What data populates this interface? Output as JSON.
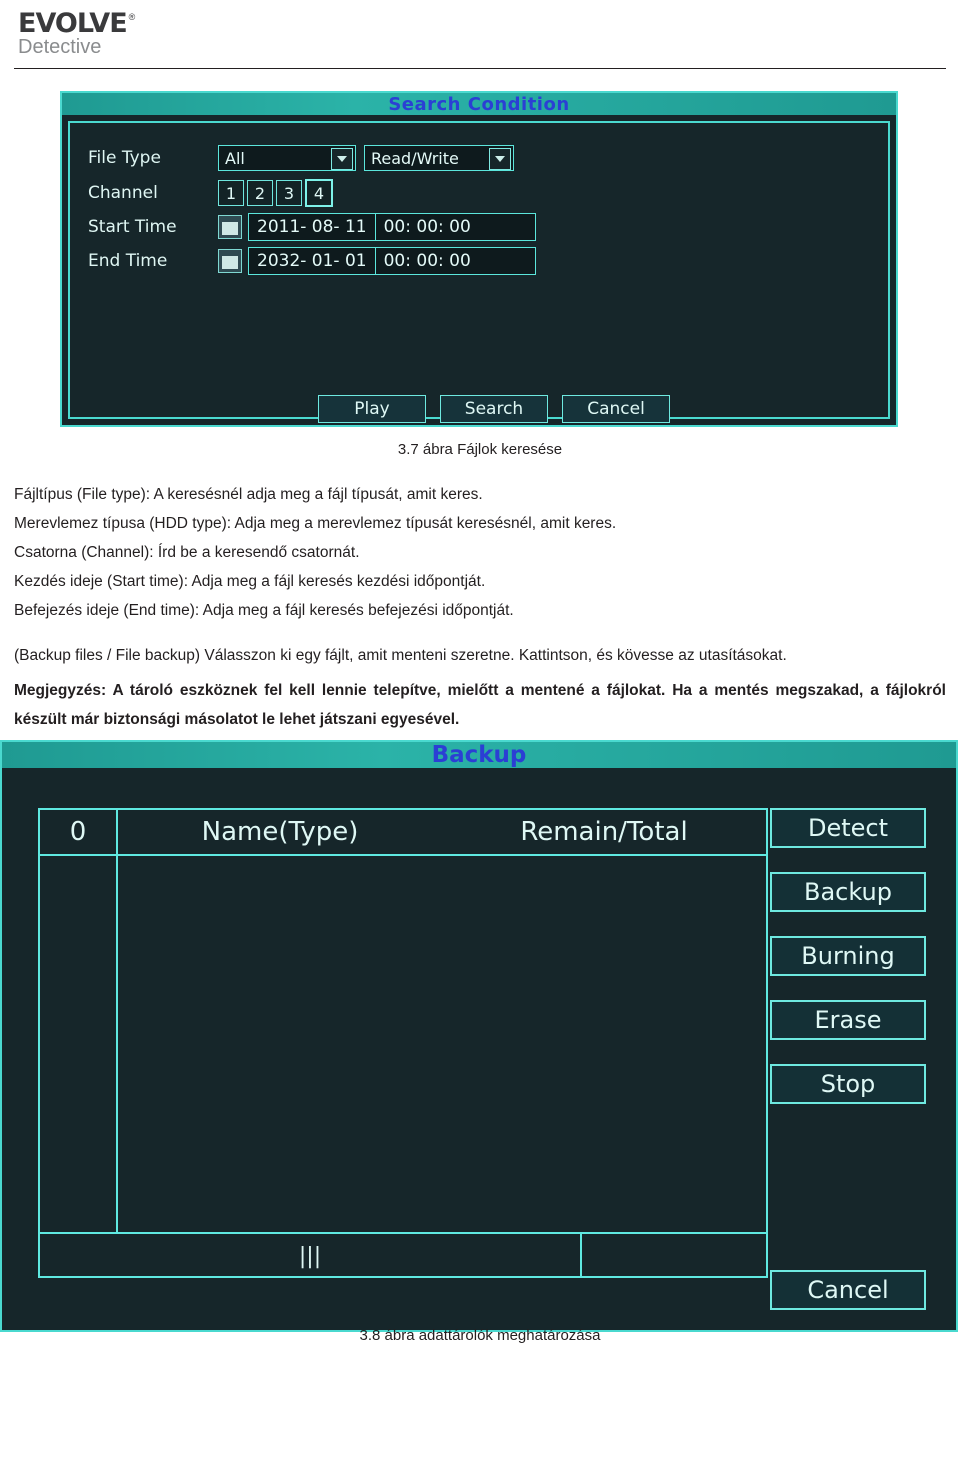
{
  "header": {
    "logo_main": "EVOLVE",
    "logo_reg": "®",
    "logo_sub": "Detective"
  },
  "figure_search": {
    "title": "Search Condition",
    "fields": {
      "file_type_label": "File Type",
      "file_type_value": "All",
      "hdd_type_value": "Read/Write",
      "channel_label": "Channel",
      "channels": [
        "1",
        "2",
        "3",
        "4"
      ],
      "start_time_label": "Start Time",
      "start_date": "2011- 08- 11",
      "start_clock": "00: 00: 00",
      "end_time_label": "End Time",
      "end_date": "2032- 01- 01",
      "end_clock": "00: 00: 00"
    },
    "buttons": {
      "play": "Play",
      "search": "Search",
      "cancel": "Cancel"
    },
    "caption": "3.7 ábra Fájlok keresése"
  },
  "body": {
    "lines": [
      "Fájltípus (File type): A keresésnél adja meg a fájl típusát, amit keres.",
      "Merevlemez típusa (HDD type): Adja meg a merevlemez típusát keresésnél, amit keres.",
      "Csatorna (Channel): Írd be a keresendő csatornát.",
      "Kezdés ideje (Start time): Adja meg a fájl keresés kezdési időpontját.",
      "Befejezés ideje (End time): Adja meg a fájl keresés befejezési időpontját."
    ],
    "para_backup": "(Backup files / File backup) Válasszon ki egy fájlt, amit menteni szeretne. Kattintson, és kövesse az utasításokat.",
    "para_note": "Megjegyzés: A tároló eszköznek fel kell lennie telepítve, mielőtt a mentené a fájlokat. Ha a mentés megszakad, a fájlokról készült már biztonsági másolatot le lehet játszani egyesével."
  },
  "figure_backup": {
    "title": "Backup",
    "columns": {
      "index": "0",
      "name_type": "Name(Type)",
      "remain_total": "Remain/Total"
    },
    "footer_value": "|||",
    "buttons": [
      "Detect",
      "Backup",
      "Burning",
      "Erase",
      "Stop"
    ],
    "cancel": "Cancel",
    "caption": "3.8 ábra adattárolók meghatározása"
  },
  "colors": {
    "panel_bg": "#16262a",
    "accent": "#4ad9cf",
    "title_text": "#2b3fd4",
    "titlebar": "#2bb3a8"
  }
}
